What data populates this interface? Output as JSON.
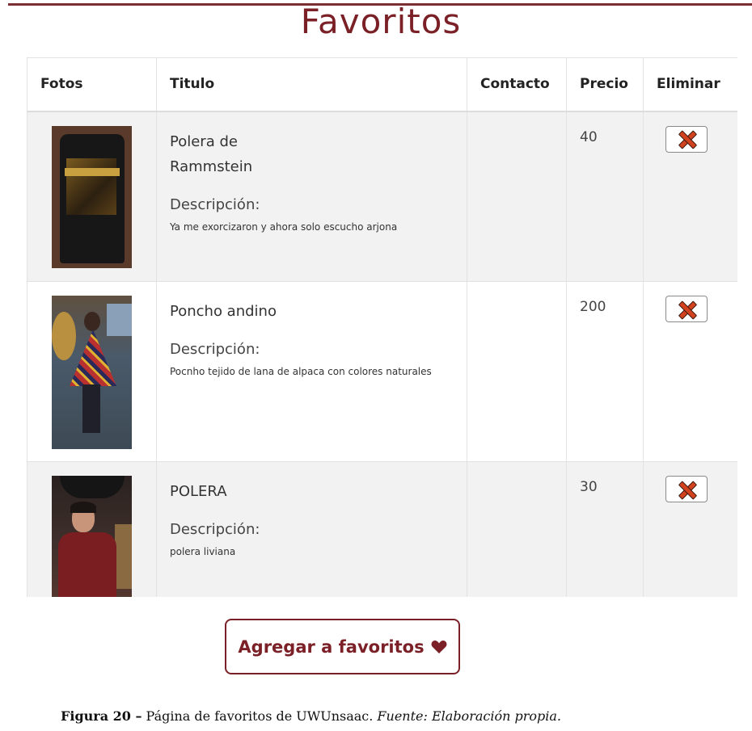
{
  "page": {
    "title": "Favoritos",
    "accent_color": "#7a2026"
  },
  "table": {
    "headers": [
      "Fotos",
      "Titulo",
      "Contacto",
      "Precio",
      "Eliminar"
    ],
    "rows": [
      {
        "photo_icon": "black-band-tshirt-photo",
        "title": "Polera de Rammstein",
        "desc_label": "Descripción:",
        "desc": "Ya me exorcizaron y ahora solo escucho arjona",
        "contact": "",
        "price": "40",
        "delete_icon": "red-x-icon"
      },
      {
        "photo_icon": "andean-poncho-photo",
        "title": "Poncho andino",
        "desc_label": "Descripción:",
        "desc": "Pocnho tejido de lana de alpaca con colores naturales",
        "contact": "",
        "price": "200",
        "delete_icon": "red-x-icon"
      },
      {
        "photo_icon": "maroon-shirt-photo",
        "title": "POLERA",
        "desc_label": "Descripción:",
        "desc": "polera liviana",
        "contact": "",
        "price": "30",
        "delete_icon": "red-x-icon"
      }
    ]
  },
  "actions": {
    "add_favorites_label": "Agregar a favoritos",
    "add_favorites_icon": "heart-icon"
  },
  "caption": {
    "figure": "Figura 20 –",
    "text": " Página de favoritos de UWUnsaac. ",
    "source": "Fuente: Elaboración propia."
  }
}
